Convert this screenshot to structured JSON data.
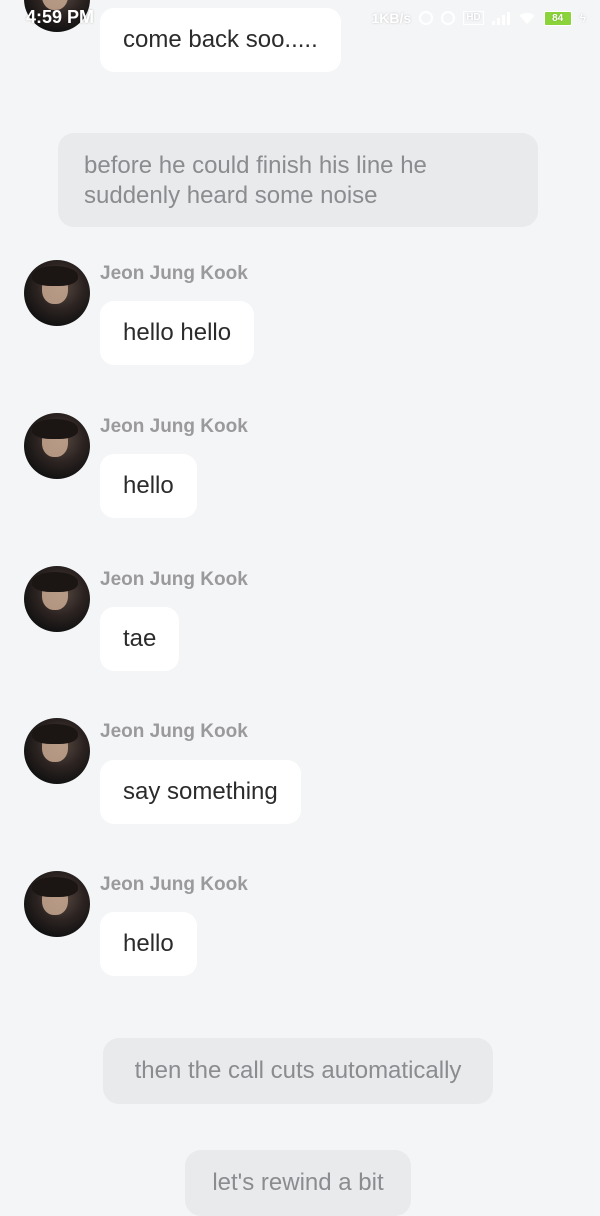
{
  "status_bar": {
    "time": "4:59 PM",
    "net_speed": "1KB/s",
    "hd_label": "HD",
    "battery": "84"
  },
  "messages": {
    "m0": {
      "text": "come back soo....."
    },
    "n1": {
      "text": "before he could finish his line he suddenly heard some noise"
    },
    "m1": {
      "name": "Jeon Jung Kook",
      "text": "hello hello"
    },
    "m2": {
      "name": "Jeon Jung Kook",
      "text": "hello"
    },
    "m3": {
      "name": "Jeon Jung Kook",
      "text": "tae"
    },
    "m4": {
      "name": "Jeon Jung Kook",
      "text": "say something"
    },
    "m5": {
      "name": "Jeon Jung Kook",
      "text": "hello"
    },
    "n2": {
      "text": "then the call cuts automatically"
    },
    "n3": {
      "text": "let's rewind a bit"
    }
  },
  "colors": {
    "background": "#f4f5f7",
    "bubble": "#ffffff",
    "narration_bubble": "#e9eaec",
    "name_text": "#9a9a9d",
    "battery": "#8bd33a"
  }
}
